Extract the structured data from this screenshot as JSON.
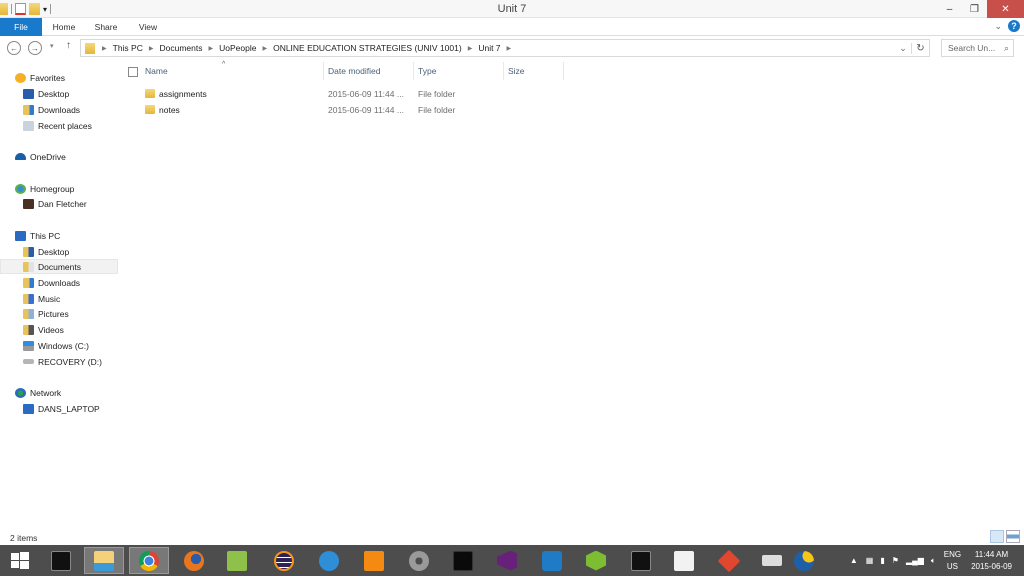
{
  "window": {
    "title": "Unit 7",
    "controls": {
      "minimize": "–",
      "restore": "❐",
      "close": "✕"
    }
  },
  "ribbon": {
    "tabs": [
      {
        "label": "File"
      },
      {
        "label": "Home"
      },
      {
        "label": "Share"
      },
      {
        "label": "View"
      }
    ],
    "help": "?"
  },
  "navigation": {
    "back": "←",
    "forward": "→",
    "recent": "▾",
    "up": "↑",
    "breadcrumb": [
      "This PC",
      "Documents",
      "UoPeople",
      "ONLINE EDUCATION STRATEGIES (UNIV 1001)",
      "Unit 7"
    ],
    "search_placeholder": "Search Un...",
    "refresh": "↻",
    "dropdown": "⌄"
  },
  "sidebar": {
    "items": [
      {
        "label": "Favorites",
        "icon": "star-icon",
        "level": 0
      },
      {
        "label": "Desktop",
        "icon": "desktop-icon",
        "level": 1
      },
      {
        "label": "Downloads",
        "icon": "downloads-icon",
        "level": 1
      },
      {
        "label": "Recent places",
        "icon": "recent-places-icon",
        "level": 1
      },
      {
        "label": "OneDrive",
        "icon": "onedrive-icon",
        "level": 0
      },
      {
        "label": "Homegroup",
        "icon": "homegroup-icon",
        "level": 0
      },
      {
        "label": "Dan Fletcher",
        "icon": "user-icon",
        "level": 1
      },
      {
        "label": "This PC",
        "icon": "computer-icon",
        "level": 0
      },
      {
        "label": "Desktop",
        "icon": "desktop-folder-icon",
        "level": 1
      },
      {
        "label": "Documents",
        "icon": "documents-icon",
        "level": 1,
        "selected": true
      },
      {
        "label": "Downloads",
        "icon": "downloads-icon",
        "level": 1
      },
      {
        "label": "Music",
        "icon": "music-icon",
        "level": 1
      },
      {
        "label": "Pictures",
        "icon": "pictures-icon",
        "level": 1
      },
      {
        "label": "Videos",
        "icon": "videos-icon",
        "level": 1
      },
      {
        "label": "Windows (C:)",
        "icon": "drive-c-icon",
        "level": 1
      },
      {
        "label": "RECOVERY (D:)",
        "icon": "drive-d-icon",
        "level": 1
      },
      {
        "label": "Network",
        "icon": "network-icon",
        "level": 0
      },
      {
        "label": "DANS_LAPTOP",
        "icon": "computer-icon",
        "level": 1
      }
    ]
  },
  "file_list": {
    "columns": [
      "Name",
      "Date modified",
      "Type",
      "Size"
    ],
    "sort_indicator": "^",
    "rows": [
      {
        "name": "assignments",
        "date": "2015-06-09 11:44 ...",
        "type": "File folder",
        "size": ""
      },
      {
        "name": "notes",
        "date": "2015-06-09 11:44 ...",
        "type": "File folder",
        "size": ""
      }
    ]
  },
  "status": {
    "items": "2 items"
  },
  "taskbar": {
    "apps": [
      {
        "name": "start-button",
        "color": "#4d4d4d"
      },
      {
        "name": "command-prompt",
        "color": "#111111"
      },
      {
        "name": "file-explorer",
        "color": "#f3d27a",
        "active": true
      },
      {
        "name": "chrome",
        "color": "#d9443a",
        "active": true
      },
      {
        "name": "firefox",
        "color": "#e8761f"
      },
      {
        "name": "notepad-plus",
        "color": "#8fc04a"
      },
      {
        "name": "eclipse",
        "color": "#2c2255"
      },
      {
        "name": "openoffice",
        "color": "#2e8ed8"
      },
      {
        "name": "sublime-editor",
        "color": "#f58a12"
      },
      {
        "name": "settings-gear",
        "color": "#9a9a9a"
      },
      {
        "name": "gitkraken-terminal",
        "color": "#0a0a0a"
      },
      {
        "name": "visual-studio",
        "color": "#68217a"
      },
      {
        "name": "speedtest",
        "color": "#1f7bc6"
      },
      {
        "name": "android-studio",
        "color": "#7cbd32"
      },
      {
        "name": "console",
        "color": "#111111"
      },
      {
        "name": "app-grid",
        "color": "#f2f2f2"
      },
      {
        "name": "git",
        "color": "#e0472e"
      },
      {
        "name": "on-screen-keyboard",
        "color": "#dddddd"
      },
      {
        "name": "help-alert",
        "color": "#1d5fa8"
      }
    ],
    "tray": {
      "language_top": "ENG",
      "language_bottom": "US",
      "time": "11:44 AM",
      "date": "2015-06-09"
    }
  }
}
